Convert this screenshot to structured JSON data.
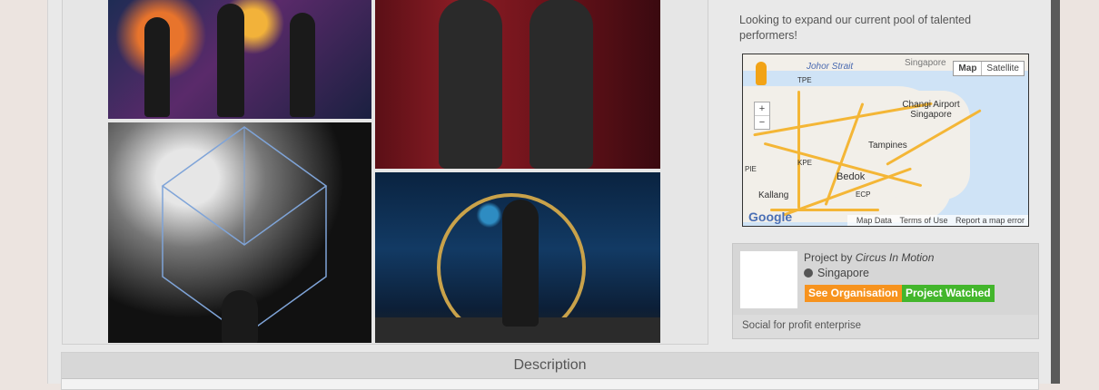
{
  "sidebar": {
    "description_text": "Looking to expand our current pool of talented performers!"
  },
  "map": {
    "type_map_label": "Map",
    "type_satellite_label": "Satellite",
    "zoom_in": "+",
    "zoom_out": "−",
    "labels": [
      "Johor Strait",
      "Singapore",
      "Changi Airport Singapore",
      "Tampines",
      "Bedok",
      "Kallang",
      "KPE",
      "ECP",
      "PIE",
      "TPE"
    ],
    "footer": {
      "map_data": "Map Data",
      "terms": "Terms of Use",
      "report": "Report a map error"
    },
    "logo": "Google"
  },
  "organisation": {
    "project_by_prefix": "Project by",
    "name": "Circus In Motion",
    "location": "Singapore",
    "see_org_label": "See Organisation",
    "watched_label": "Project Watched",
    "type": "Social for profit enterprise"
  },
  "description": {
    "header": "Description"
  },
  "colors": {
    "orange": "#f7931e",
    "green": "#43b62c"
  }
}
